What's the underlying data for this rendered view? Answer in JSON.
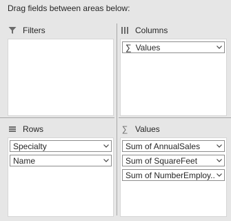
{
  "instruction": "Drag fields between areas below:",
  "areas": {
    "filters": {
      "label": "Filters",
      "icon": "filter-icon",
      "fields": []
    },
    "columns": {
      "label": "Columns",
      "icon": "columns-icon",
      "fields": [
        {
          "label": "Values",
          "prefix": "∑"
        }
      ]
    },
    "rows": {
      "label": "Rows",
      "icon": "rows-icon",
      "fields": [
        {
          "label": "Specialty"
        },
        {
          "label": "Name"
        }
      ]
    },
    "values": {
      "label": "Values",
      "icon": "sigma-icon",
      "fields": [
        {
          "label": "Sum of AnnualSales"
        },
        {
          "label": "Sum of SquareFeet"
        },
        {
          "label": "Sum of NumberEmploy..."
        }
      ]
    }
  },
  "colors": {
    "panel_bg": "#e6e6e6",
    "box_bg": "#ffffff",
    "field_border": "#8c8c8c",
    "divider": "#a6a6a6"
  }
}
